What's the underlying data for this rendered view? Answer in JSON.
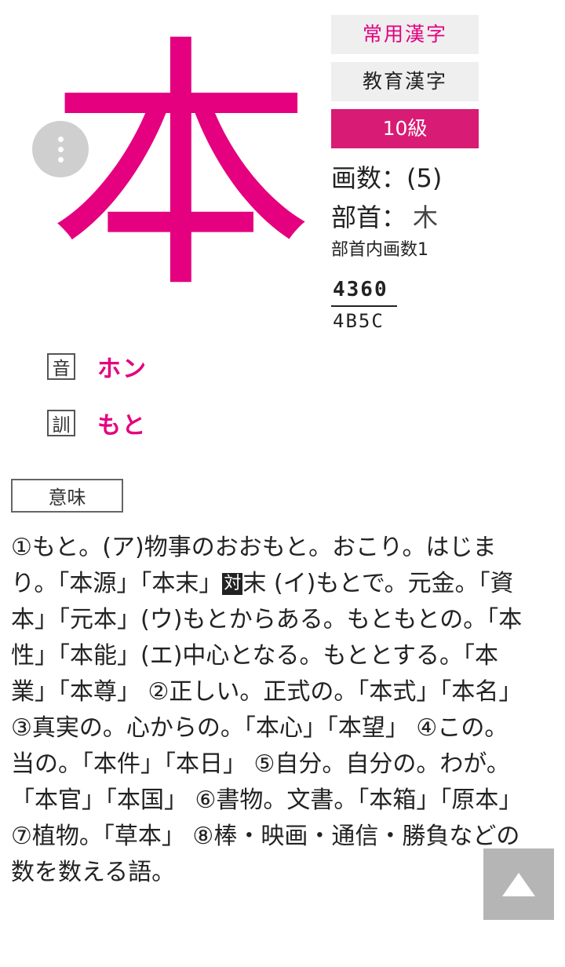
{
  "kanji": {
    "character": "本",
    "color": "#e4007f"
  },
  "more_button": {
    "icon": "more-vertical-icon"
  },
  "badges": {
    "joyo": "常用漢字",
    "kyoiku": "教育漢字",
    "level": "10級",
    "level_color": "#d81b74"
  },
  "info": {
    "strokes": "画数：(5)",
    "radical_label": "部首：",
    "radical_char": "木",
    "inner_strokes": "部首内画数1",
    "code_top": "4360",
    "code_bottom": "4B5C"
  },
  "readings": {
    "on_tag": "音",
    "on_value": "ホン",
    "kun_tag": "訓",
    "kun_value": "もと"
  },
  "meaning": {
    "tab_label": "意味",
    "text_part1": "①もと。(ア)物事のおおもと。おこり。はじまり。「本源」「本末」",
    "antonym_label": "対",
    "text_part2": "末 (イ)もとで。元金。「資本」「元本」(ウ)もとからある。もともとの。「本性」「本能」(エ)中心となる。もととする。「本業」「本尊」 ②正しい。正式の。「本式」「本名」 ③真実の。心からの。「本心」「本望」 ④この。当の。「本件」「本日」 ⑤自分。自分の。わが。「本官」「本国」 ⑥書物。文書。「本箱」「原本」 ⑦植物。「草本」 ⑧棒・映画・通信・勝負などの数を数える語。"
  },
  "scroll_top": {
    "icon": "arrow-up-icon"
  }
}
